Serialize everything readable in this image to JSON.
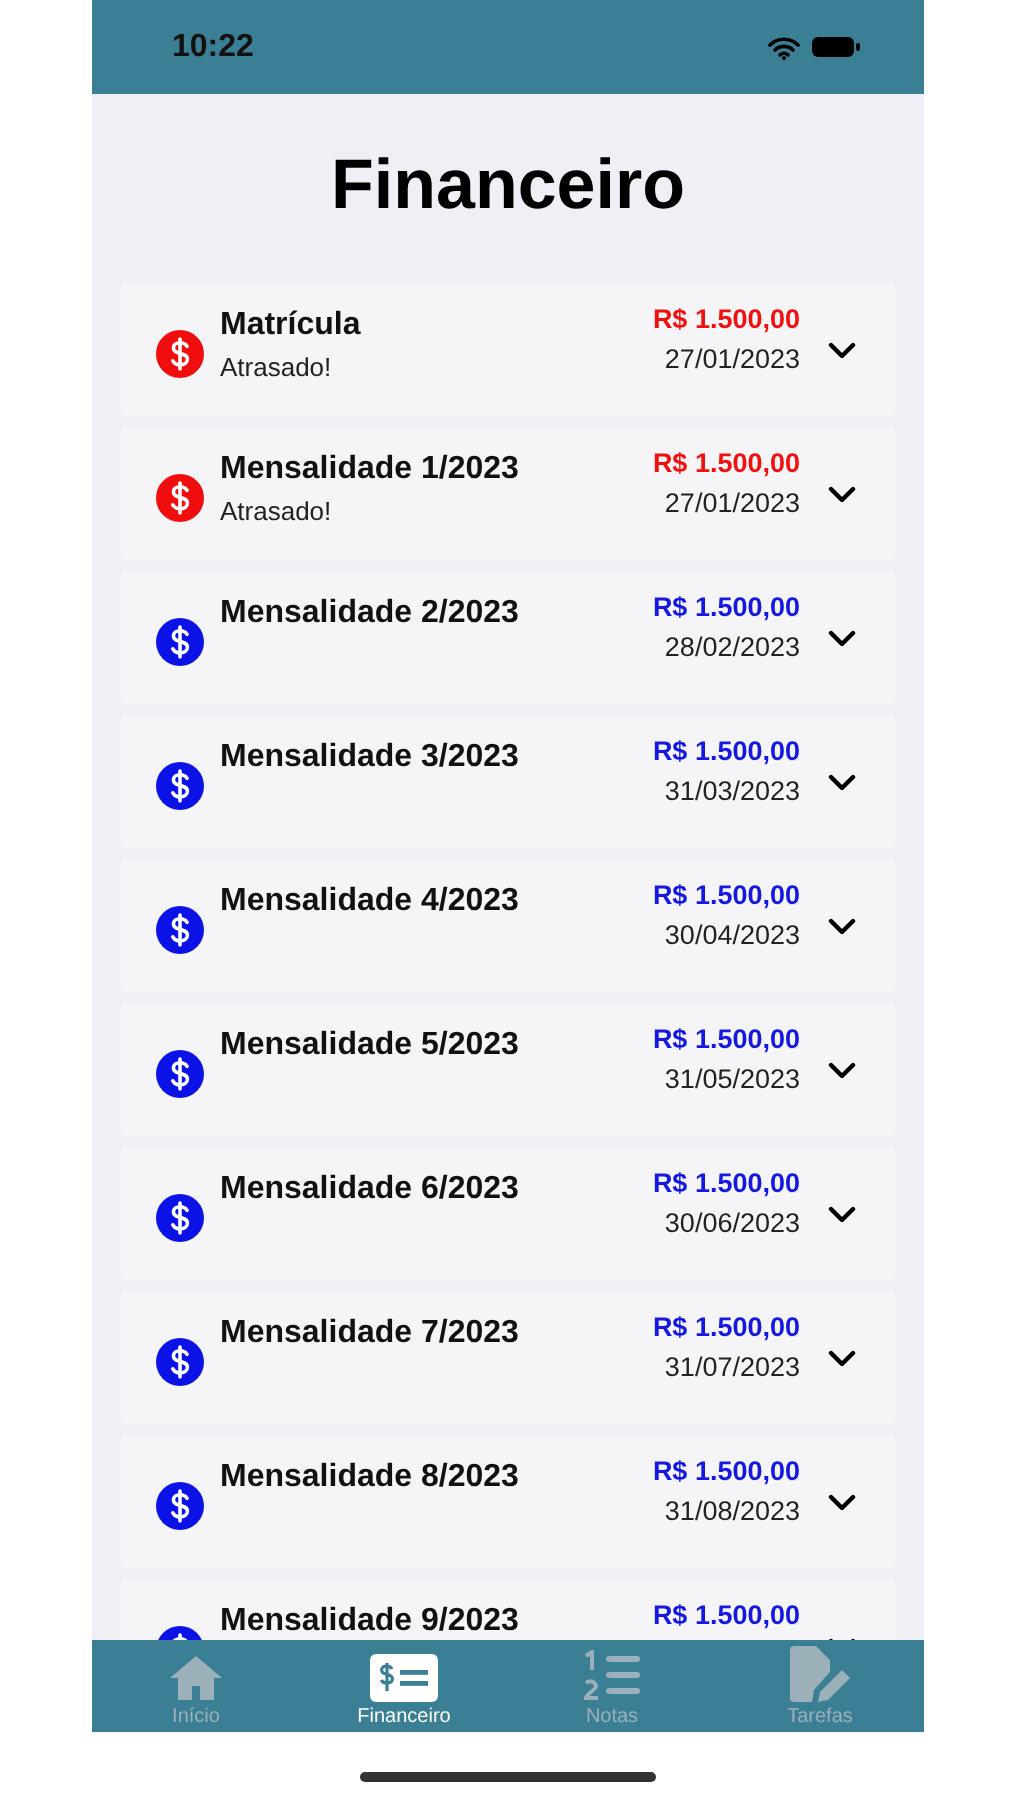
{
  "status_bar": {
    "time": "10:22"
  },
  "title": "Financeiro",
  "payments": [
    {
      "name": "Matrícula",
      "note": "Atrasado!",
      "overdue": true,
      "amount": "R$ 1.500,00",
      "date": "27/01/2023"
    },
    {
      "name": "Mensalidade 1/2023",
      "note": "Atrasado!",
      "overdue": true,
      "amount": "R$ 1.500,00",
      "date": "27/01/2023"
    },
    {
      "name": "Mensalidade 2/2023",
      "overdue": false,
      "amount": "R$ 1.500,00",
      "date": "28/02/2023"
    },
    {
      "name": "Mensalidade 3/2023",
      "overdue": false,
      "amount": "R$ 1.500,00",
      "date": "31/03/2023"
    },
    {
      "name": "Mensalidade 4/2023",
      "overdue": false,
      "amount": "R$ 1.500,00",
      "date": "30/04/2023"
    },
    {
      "name": "Mensalidade 5/2023",
      "overdue": false,
      "amount": "R$ 1.500,00",
      "date": "31/05/2023"
    },
    {
      "name": "Mensalidade 6/2023",
      "overdue": false,
      "amount": "R$ 1.500,00",
      "date": "30/06/2023"
    },
    {
      "name": "Mensalidade 7/2023",
      "overdue": false,
      "amount": "R$ 1.500,00",
      "date": "31/07/2023"
    },
    {
      "name": "Mensalidade 8/2023",
      "overdue": false,
      "amount": "R$ 1.500,00",
      "date": "31/08/2023"
    },
    {
      "name": "Mensalidade 9/2023",
      "overdue": false,
      "amount": "R$ 1.500,00"
    }
  ],
  "tabs": [
    {
      "label": "Início",
      "selected": false
    },
    {
      "label": "Financeiro",
      "selected": true
    },
    {
      "label": "Notas",
      "selected": false
    },
    {
      "label": "Tarefas",
      "selected": false
    }
  ]
}
